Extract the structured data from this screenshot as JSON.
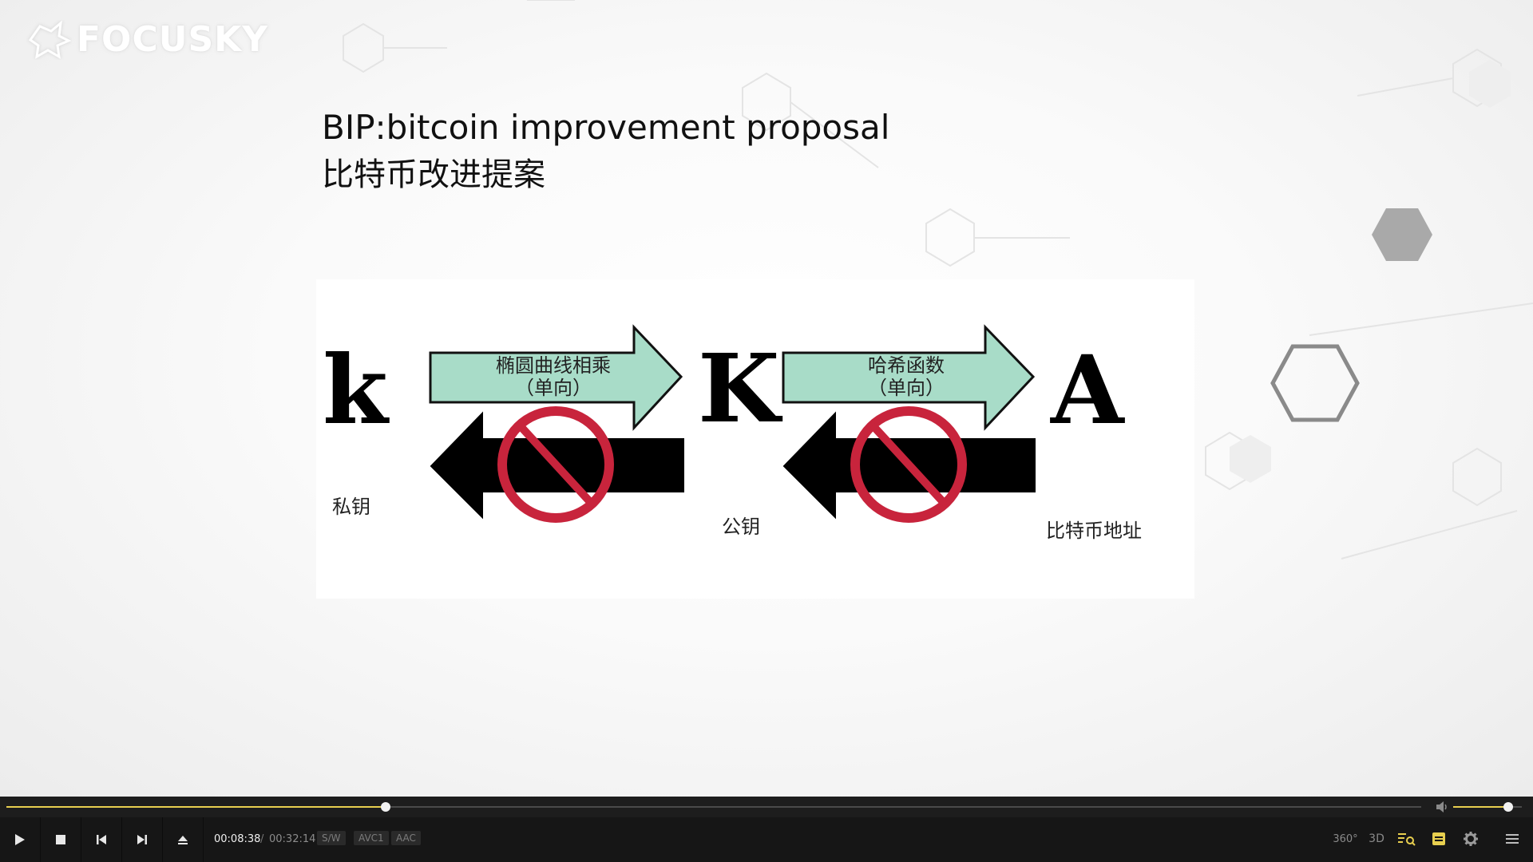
{
  "logo": {
    "text": "FOCUSKY"
  },
  "slide": {
    "title_line1": "BIP:bitcoin improvement proposal",
    "title_line2": "比特币改进提案"
  },
  "diagram": {
    "private_key_symbol": "k",
    "public_key_symbol": "K",
    "address_symbol": "A",
    "arrow1_label_line1": "椭圆曲线相乘",
    "arrow1_label_line2": "（单向）",
    "arrow2_label_line1": "哈希函数",
    "arrow2_label_line2": "（单向）",
    "private_key_caption": "私钥",
    "public_key_caption": "公钥",
    "address_caption": "比特币地址"
  },
  "player": {
    "current_time": "00:08:38",
    "separator": "/",
    "total_time": "00:32:14",
    "progress_fraction": 0.268,
    "volume_fraction": 0.8,
    "badges": [
      "S/W",
      "AVC1",
      "AAC"
    ],
    "right_icons": {
      "vr360": "360°",
      "mode3d": "3D"
    }
  },
  "colors": {
    "arrow_fill": "#a8dcc8",
    "forbidden_red": "#c8243c",
    "progress_accent": "#e8cf4f",
    "control_bar": "#161616"
  }
}
